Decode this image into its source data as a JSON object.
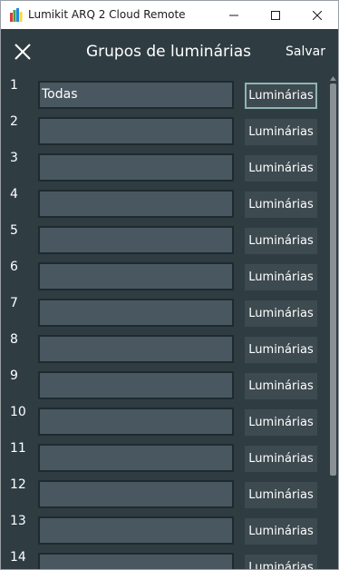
{
  "window": {
    "title": "Lumikit ARQ 2 Cloud Remote",
    "app_icon_colors": [
      "#e53935",
      "#43a047",
      "#1e88e5",
      "#fdd835"
    ]
  },
  "header": {
    "title": "Grupos de luminárias",
    "save_label": "Salvar"
  },
  "colors": {
    "background": "#2f3d43",
    "input_background": "#495860",
    "button_background": "#3d4a50",
    "focus_border": "#8fb5b0"
  },
  "groups": [
    {
      "number": "1",
      "name": "Todas",
      "button_label": "Luminárias"
    },
    {
      "number": "2",
      "name": "",
      "button_label": "Luminárias"
    },
    {
      "number": "3",
      "name": "",
      "button_label": "Luminárias"
    },
    {
      "number": "4",
      "name": "",
      "button_label": "Luminárias"
    },
    {
      "number": "5",
      "name": "",
      "button_label": "Luminárias"
    },
    {
      "number": "6",
      "name": "",
      "button_label": "Luminárias"
    },
    {
      "number": "7",
      "name": "",
      "button_label": "Luminárias"
    },
    {
      "number": "8",
      "name": "",
      "button_label": "Luminárias"
    },
    {
      "number": "9",
      "name": "",
      "button_label": "Luminárias"
    },
    {
      "number": "10",
      "name": "",
      "button_label": "Luminárias"
    },
    {
      "number": "11",
      "name": "",
      "button_label": "Luminárias"
    },
    {
      "number": "12",
      "name": "",
      "button_label": "Luminárias"
    },
    {
      "number": "13",
      "name": "",
      "button_label": "Luminárias"
    },
    {
      "number": "14",
      "name": "",
      "button_label": "Luminárias"
    }
  ]
}
